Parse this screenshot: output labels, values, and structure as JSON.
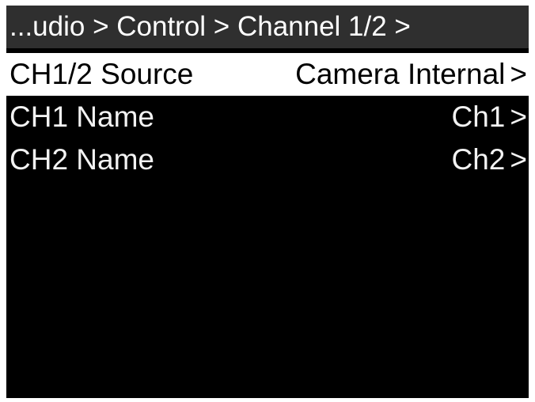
{
  "breadcrumb": "...udio > Control > Channel 1/2 >",
  "menu": {
    "items": [
      {
        "label": "CH1/2 Source",
        "value": "Camera Internal",
        "chevron": ">",
        "selected": true
      },
      {
        "label": "CH1 Name",
        "value": "Ch1",
        "chevron": ">",
        "selected": false
      },
      {
        "label": "CH2 Name",
        "value": "Ch2",
        "chevron": ">",
        "selected": false
      }
    ]
  },
  "colors": {
    "background": "#000000",
    "header_bg": "#2f2f2f",
    "selected_bg": "#ffffff",
    "text": "#ffffff"
  }
}
